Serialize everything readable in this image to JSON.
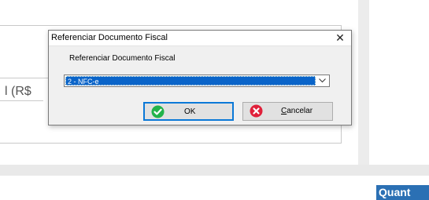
{
  "background": {
    "label_fragment": "l (R$",
    "button_label": "Quant"
  },
  "dialog": {
    "title": "Referenciar Documento Fiscal",
    "close_glyph": "✕",
    "prompt": "Referenciar Documento Fiscal",
    "combo": {
      "selected": "2 - NFC-e"
    },
    "ok_button": {
      "label": "OK",
      "icon": "checkmark-icon",
      "icon_color": "#22b34a"
    },
    "cancel_button": {
      "label": "Cancelar",
      "icon": "cancel-x-icon",
      "icon_color": "#e0203a"
    }
  },
  "colors": {
    "accent": "#0a78d7",
    "selection": "#0a64c9",
    "quant_button": "#2b70b4"
  }
}
